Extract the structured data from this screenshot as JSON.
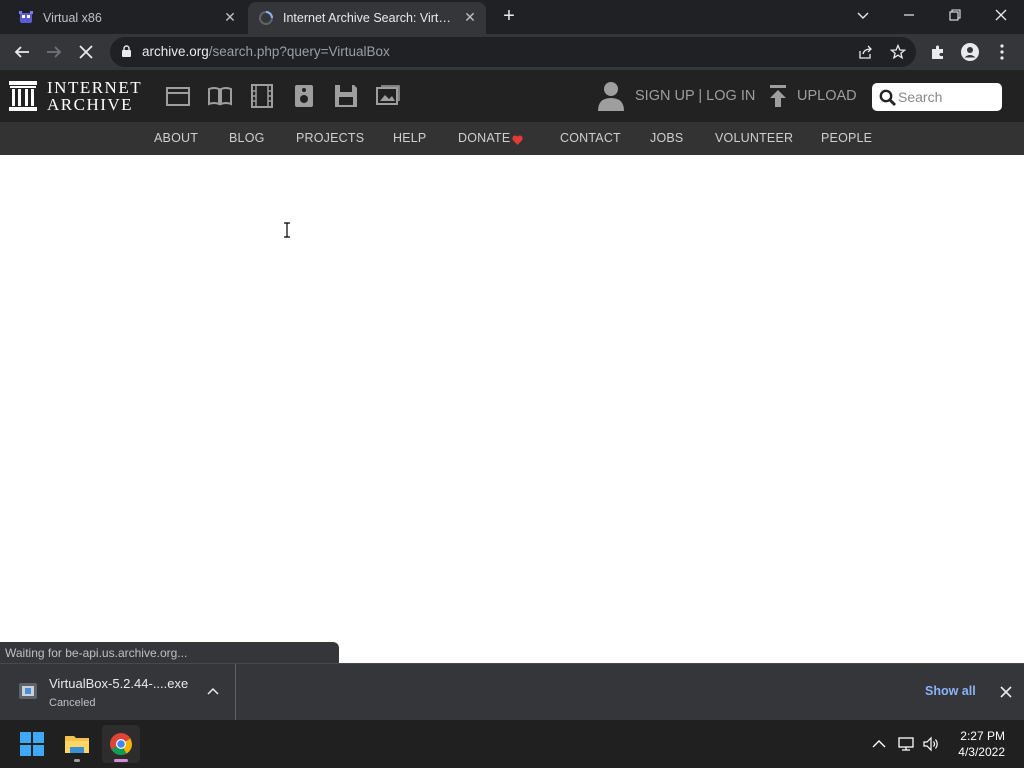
{
  "browser": {
    "tabs": [
      {
        "title": "Virtual x86",
        "active": false
      },
      {
        "title": "Internet Archive Search: VirtualBox",
        "active": true
      }
    ],
    "url_host": "archive.org",
    "url_path": "/search.php?query=VirtualBox"
  },
  "ia_header": {
    "logo_line1": "INTERNET",
    "logo_line2": "ARCHIVE",
    "media_icons": [
      "web-icon",
      "texts-icon",
      "video-icon",
      "audio-icon",
      "software-icon",
      "images-icon"
    ],
    "signup_label": "SIGN UP | LOG IN",
    "upload_label": "UPLOAD",
    "search_placeholder": "Search"
  },
  "ia_nav": {
    "items": [
      "ABOUT",
      "BLOG",
      "PROJECTS",
      "HELP",
      "DONATE",
      "CONTACT",
      "JOBS",
      "VOLUNTEER",
      "PEOPLE"
    ]
  },
  "status_bar": {
    "text": "Waiting for be-api.us.archive.org..."
  },
  "download_shelf": {
    "filename": "VirtualBox-5.2.44-....exe",
    "status": "Canceled",
    "show_all_label": "Show all"
  },
  "taskbar": {
    "time": "2:27 PM",
    "date": "4/3/2022"
  },
  "colors": {
    "tab_active": "#35363a",
    "ia_header_bg": "#222222",
    "ia_nav_bg": "#333333",
    "donate_heart": "#e53935",
    "link_blue": "#8ab4f8"
  }
}
